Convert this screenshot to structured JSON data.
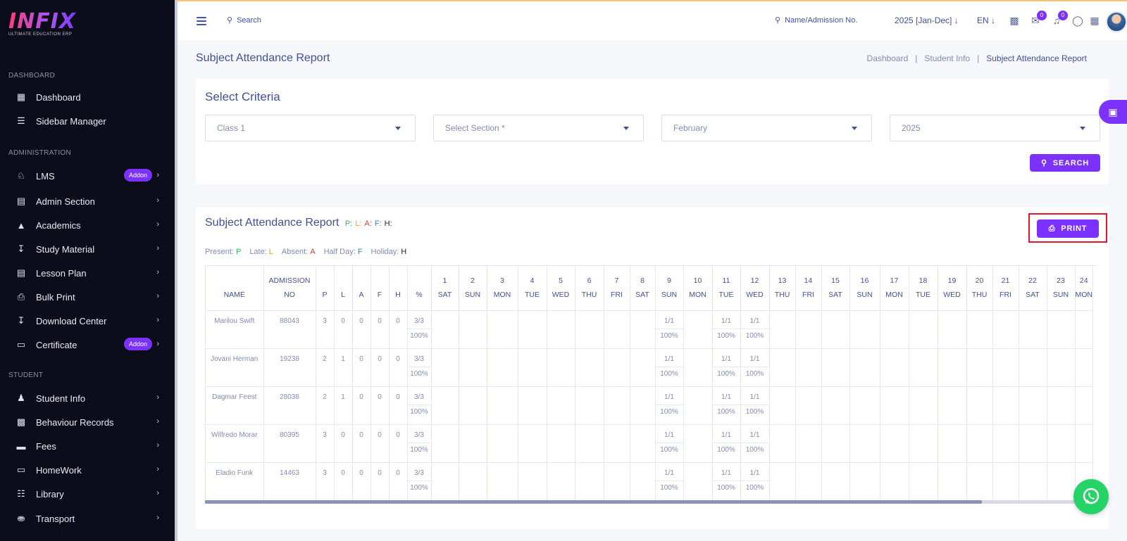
{
  "brand": {
    "logo": "INFIX",
    "tagline": "ULTIMATE EDUCATION ERP"
  },
  "sidebar": {
    "sections": [
      {
        "label": "DASHBOARD",
        "items": [
          {
            "label": "Dashboard",
            "icon": "grid-icon"
          },
          {
            "label": "Sidebar Manager",
            "icon": "menu-icon"
          }
        ]
      },
      {
        "label": "ADMINISTRATION",
        "items": [
          {
            "label": "LMS",
            "icon": "lms-icon",
            "badge": "Addon"
          },
          {
            "label": "Admin Section",
            "icon": "admin-icon"
          },
          {
            "label": "Academics",
            "icon": "graduation-cap-icon"
          },
          {
            "label": "Study Material",
            "icon": "download-icon"
          },
          {
            "label": "Lesson Plan",
            "icon": "list-icon"
          },
          {
            "label": "Bulk Print",
            "icon": "printer-icon"
          },
          {
            "label": "Download Center",
            "icon": "download-icon"
          },
          {
            "label": "Certificate",
            "icon": "book-icon",
            "badge": "Addon"
          }
        ]
      },
      {
        "label": "STUDENT",
        "items": [
          {
            "label": "Student Info",
            "icon": "user-icon"
          },
          {
            "label": "Behaviour Records",
            "icon": "records-icon"
          },
          {
            "label": "Fees",
            "icon": "money-icon"
          },
          {
            "label": "HomeWork",
            "icon": "book-open-icon"
          },
          {
            "label": "Library",
            "icon": "library-icon"
          },
          {
            "label": "Transport",
            "icon": "bus-icon"
          }
        ]
      }
    ]
  },
  "topbar": {
    "search_label": "Search",
    "name_search_label": "Name/Admission No.",
    "year": "2025 [Jan-Dec]",
    "language": "EN",
    "message_count": "0",
    "notification_count": "0"
  },
  "page": {
    "title": "Subject Attendance Report",
    "breadcrumb": [
      "Dashboard",
      "Student Info",
      "Subject Attendance Report"
    ]
  },
  "criteria": {
    "title": "Select Criteria",
    "class": "Class 1",
    "section": "Select Section *",
    "month": "February",
    "year": "2025",
    "search_button": "SEARCH"
  },
  "report": {
    "title": "Subject Attendance Report",
    "title_legend": [
      {
        "code": "P:",
        "color": "#2bbf60"
      },
      {
        "code": "L:",
        "color": "#f0a020"
      },
      {
        "code": "A:",
        "color": "#e53935"
      },
      {
        "code": "F:",
        "color": "#2a86c9"
      },
      {
        "code": "H:",
        "color": "#222222"
      }
    ],
    "legend": [
      {
        "label": "Present:",
        "code": "P",
        "color": "#2bbf60"
      },
      {
        "label": "Late:",
        "code": "L",
        "color": "#f0a020"
      },
      {
        "label": "Absent:",
        "code": "A",
        "color": "#e53935"
      },
      {
        "label": "Half Day:",
        "code": "F",
        "color": "#2a86c9"
      },
      {
        "label": "Holiday:",
        "code": "H",
        "color": "#222222"
      }
    ],
    "print_button": "PRINT",
    "columns": {
      "name": "NAME",
      "admission": [
        "ADMISSION",
        "NO"
      ],
      "stats": [
        "P",
        "L",
        "A",
        "F",
        "H",
        "%"
      ]
    },
    "days": [
      {
        "d": "1",
        "w": "SAT"
      },
      {
        "d": "2",
        "w": "SUN"
      },
      {
        "d": "3",
        "w": "MON"
      },
      {
        "d": "4",
        "w": "TUE"
      },
      {
        "d": "5",
        "w": "WED"
      },
      {
        "d": "6",
        "w": "THU"
      },
      {
        "d": "7",
        "w": "FRI"
      },
      {
        "d": "8",
        "w": "SAT"
      },
      {
        "d": "9",
        "w": "SUN"
      },
      {
        "d": "10",
        "w": "MON"
      },
      {
        "d": "11",
        "w": "TUE"
      },
      {
        "d": "12",
        "w": "WED"
      },
      {
        "d": "13",
        "w": "THU"
      },
      {
        "d": "14",
        "w": "FRI"
      },
      {
        "d": "15",
        "w": "SAT"
      },
      {
        "d": "16",
        "w": "SUN"
      },
      {
        "d": "17",
        "w": "MON"
      },
      {
        "d": "18",
        "w": "TUE"
      },
      {
        "d": "19",
        "w": "WED"
      },
      {
        "d": "20",
        "w": "THU"
      },
      {
        "d": "21",
        "w": "FRI"
      },
      {
        "d": "22",
        "w": "SAT"
      },
      {
        "d": "23",
        "w": "SUN"
      },
      {
        "d": "24",
        "w": "MON"
      }
    ],
    "rows": [
      {
        "name": "Marilou Swift",
        "admission": "88043",
        "P": "3",
        "L": "0",
        "A": "0",
        "F": "0",
        "H": "0",
        "ratio": "3/3",
        "percent": "100%",
        "marks": {
          "9": [
            "1/1",
            "100%"
          ],
          "11": [
            "1/1",
            "100%"
          ],
          "12": [
            "1/1",
            "100%"
          ]
        }
      },
      {
        "name": "Jovani Herman",
        "admission": "19238",
        "P": "2",
        "L": "1",
        "A": "0",
        "F": "0",
        "H": "0",
        "ratio": "3/3",
        "percent": "100%",
        "marks": {
          "9": [
            "1/1",
            "100%"
          ],
          "11": [
            "1/1",
            "100%"
          ],
          "12": [
            "1/1",
            "100%"
          ]
        }
      },
      {
        "name": "Dagmar Feest",
        "admission": "28038",
        "P": "2",
        "L": "1",
        "A": "0",
        "F": "0",
        "H": "0",
        "ratio": "3/3",
        "percent": "100%",
        "marks": {
          "9": [
            "1/1",
            "100%"
          ],
          "11": [
            "1/1",
            "100%"
          ],
          "12": [
            "1/1",
            "100%"
          ]
        }
      },
      {
        "name": "Wilfredo Morar",
        "admission": "80395",
        "P": "3",
        "L": "0",
        "A": "0",
        "F": "0",
        "H": "0",
        "ratio": "3/3",
        "percent": "100%",
        "marks": {
          "9": [
            "1/1",
            "100%"
          ],
          "11": [
            "1/1",
            "100%"
          ],
          "12": [
            "1/1",
            "100%"
          ]
        }
      },
      {
        "name": "Eladio Funk",
        "admission": "14463",
        "P": "3",
        "L": "0",
        "A": "0",
        "F": "0",
        "H": "0",
        "ratio": "3/3",
        "percent": "100%",
        "marks": {
          "9": [
            "1/1",
            "100%"
          ],
          "11": [
            "1/1",
            "100%"
          ],
          "12": [
            "1/1",
            "100%"
          ]
        }
      }
    ]
  },
  "colors": {
    "accent": "#7c32ff",
    "text": "#415094",
    "muted": "#828bb2",
    "sidebar_bg": "#0b0d1a",
    "whatsapp": "#25d366",
    "highlight": "#e5142a"
  }
}
